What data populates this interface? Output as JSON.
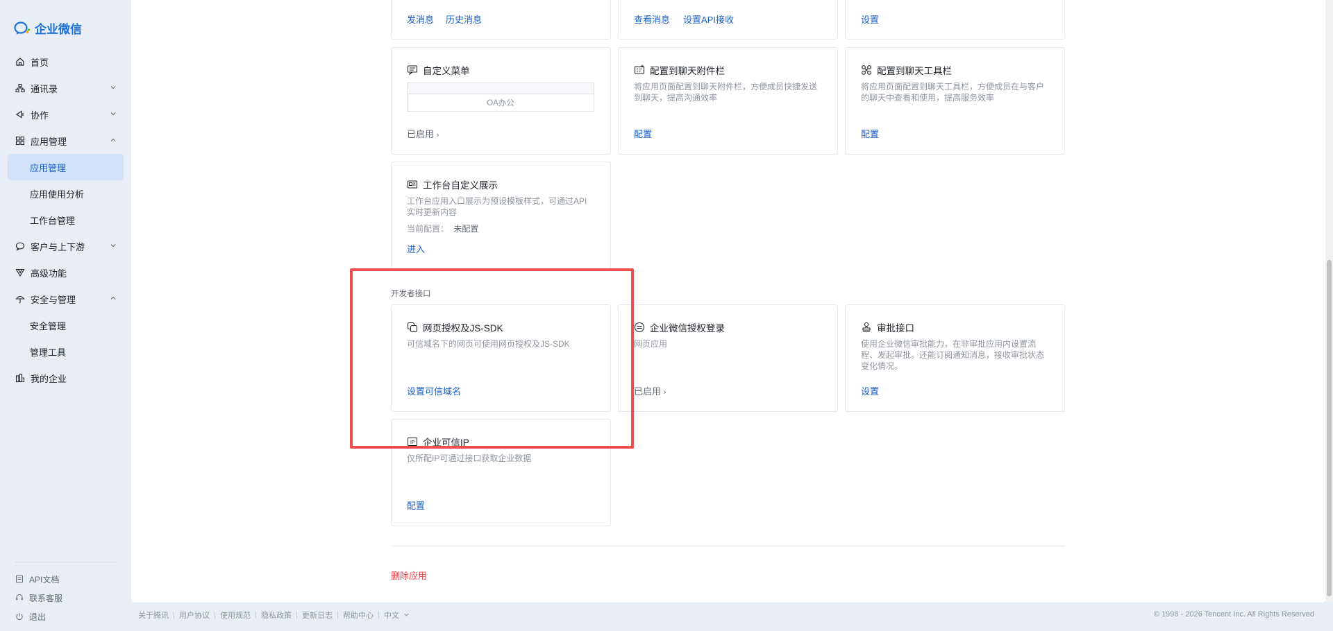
{
  "app": {
    "name": "企业微信",
    "brand_color": "#1a72d6"
  },
  "sidebar": {
    "items": [
      {
        "label": "首页",
        "icon": "home-icon"
      },
      {
        "label": "通讯录",
        "icon": "org-icon",
        "chevron": "down"
      },
      {
        "label": "协作",
        "icon": "collab-icon",
        "chevron": "down"
      },
      {
        "label": "应用管理",
        "icon": "apps-icon",
        "chevron": "up"
      },
      {
        "label": "应用管理",
        "sub": true,
        "active": true
      },
      {
        "label": "应用使用分析",
        "sub": true
      },
      {
        "label": "工作台管理",
        "sub": true
      },
      {
        "label": "客户与上下游",
        "icon": "chat-icon",
        "chevron": "down"
      },
      {
        "label": "高级功能",
        "icon": "advanced-icon"
      },
      {
        "label": "安全与管理",
        "icon": "umbrella-icon",
        "chevron": "up"
      },
      {
        "label": "安全管理",
        "sub": true
      },
      {
        "label": "管理工具",
        "sub": true
      },
      {
        "label": "我的企业",
        "icon": "company-icon"
      }
    ],
    "footer": [
      {
        "label": "API文档",
        "icon": "doc-icon"
      },
      {
        "label": "联系客服",
        "icon": "support-icon"
      },
      {
        "label": "退出",
        "icon": "power-icon"
      }
    ]
  },
  "top_cards": [
    {
      "links": [
        "发消息",
        "历史消息"
      ]
    },
    {
      "links": [
        "查看消息",
        "设置API接收"
      ]
    },
    {
      "links": [
        "设置"
      ]
    }
  ],
  "cards": {
    "custom_menu": {
      "title": "自定义菜单",
      "preview_label": "OA办公",
      "status": "已启用"
    },
    "chat_attachment": {
      "title": "配置到聊天附件栏",
      "desc": "将应用页面配置到聊天附件栏，方便成员快捷发送到聊天，提高沟通效率",
      "link": "配置"
    },
    "chat_toolbar": {
      "title": "配置到聊天工具栏",
      "desc": "将应用页面配置到聊天工具栏，方便成员在与客户的聊天中查看和使用，提高服务效率",
      "link": "配置"
    },
    "workbench": {
      "title": "工作台自定义展示",
      "desc": "工作台应用入口展示为预设模板样式，可通过API实时更新内容",
      "config_label": "当前配置：",
      "config_value": "未配置",
      "link": "进入"
    }
  },
  "developer": {
    "section_label": "开发者接口",
    "web_auth": {
      "title": "网页授权及JS-SDK",
      "desc": "可信域名下的网页可使用网页授权及JS-SDK",
      "link": "设置可信域名"
    },
    "wecom_login": {
      "title": "企业微信授权登录",
      "desc": "网页应用",
      "status": "已启用"
    },
    "approval": {
      "title": "审批接口",
      "desc": "使用企业微信审批能力，在非审批应用内设置流程、发起审批。还能订阅通知消息，接收审批状态变化情况。",
      "link": "设置"
    },
    "trusted_ip": {
      "title": "企业可信IP",
      "desc": "仅所配IP可通过接口获取企业数据",
      "link": "配置"
    }
  },
  "delete_label": "删除应用",
  "footer": {
    "links": [
      "关于腾讯",
      "用户协议",
      "使用规范",
      "隐私政策",
      "更新日志",
      "帮助中心"
    ],
    "language": "中文",
    "copyright": "© 1998 - 2026 Tencent Inc. All Rights Reserved"
  },
  "highlight_color": "#ef4e4e"
}
